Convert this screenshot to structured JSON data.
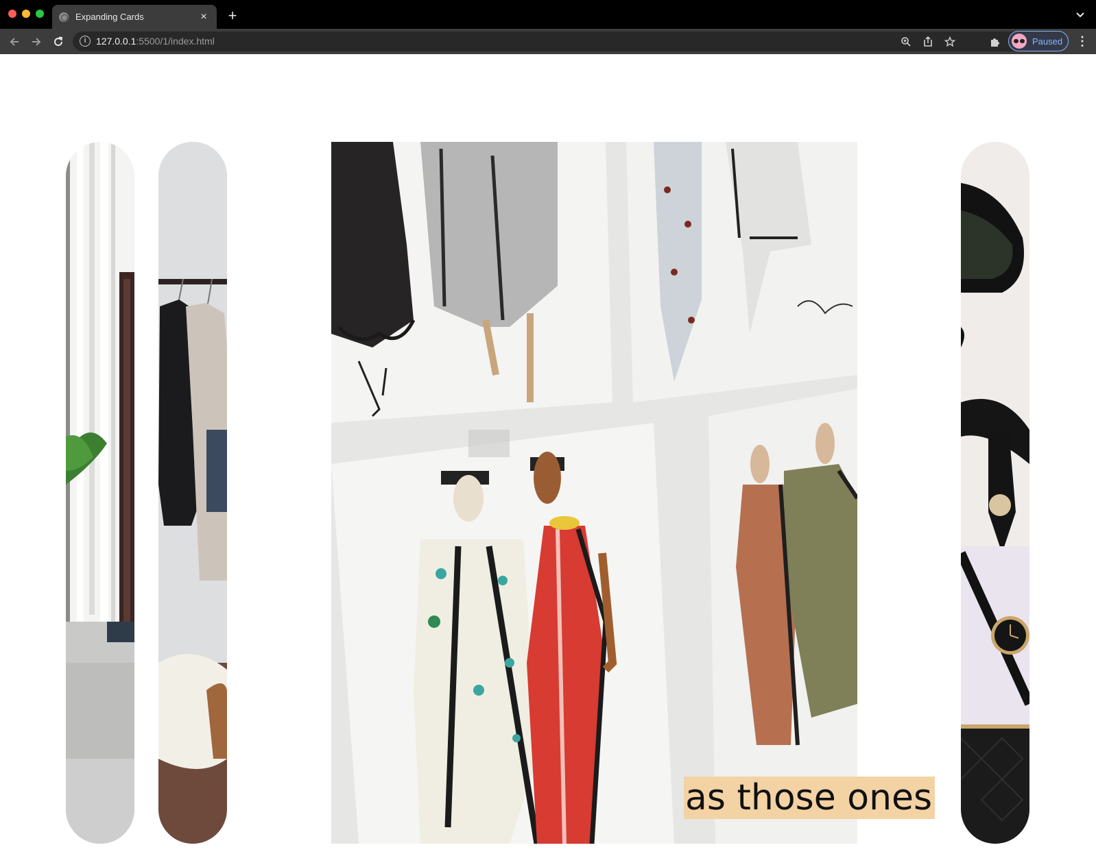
{
  "browser": {
    "tab_title": "Expanding Cards",
    "tab_close": "×",
    "new_tab": "+",
    "tab_menu_icon": "chevron-down",
    "url_host": "127.0.0.1",
    "url_path": ":5500/1/index.html",
    "profile_label": "Paused",
    "menu": "⋮"
  },
  "panels": [
    {
      "name": "panel-living-room",
      "title": "",
      "active": false
    },
    {
      "name": "panel-clothes-rack",
      "title": "",
      "active": false
    },
    {
      "name": "panel-fashion-sketches",
      "title": "as those ones",
      "active": true
    },
    {
      "name": "panel-accessories",
      "title": "",
      "active": false
    }
  ],
  "colors": {
    "chrome_bg": "#000000",
    "toolbar_bg": "#3c3c3c",
    "profile_accent": "#8ab4f8",
    "title_highlight": "#f3d2a4"
  }
}
